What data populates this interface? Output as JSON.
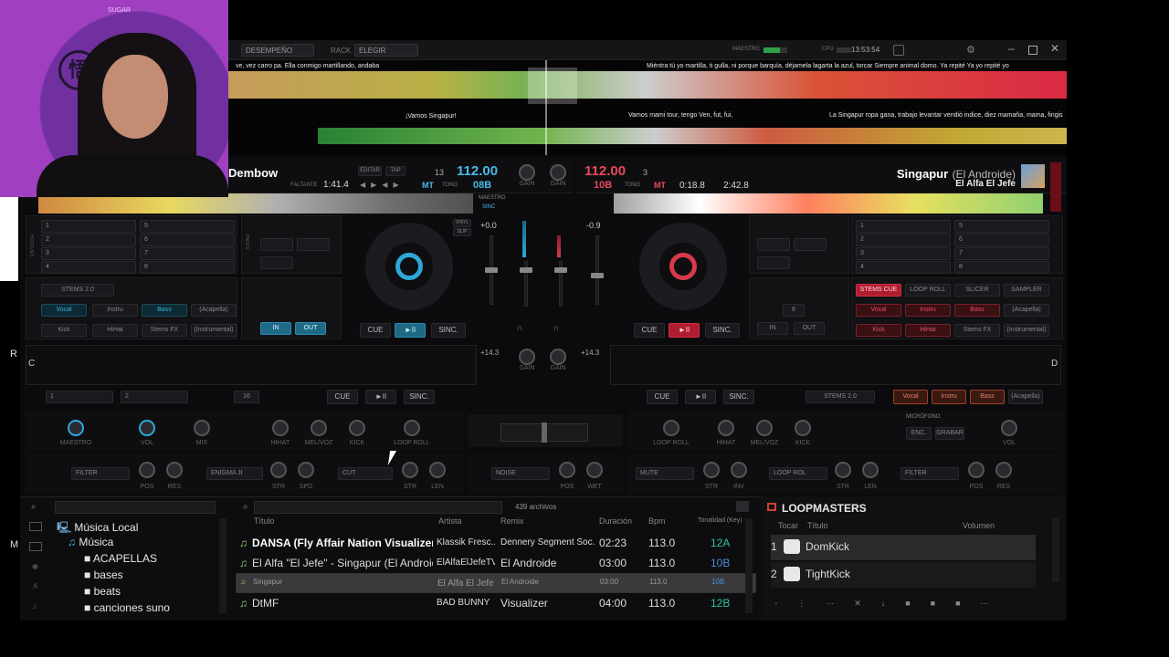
{
  "top_bar": {
    "mode_select": "DESEMPEÑO",
    "rack_label": "RACK",
    "rack_select": "ELEGIR",
    "master_label": "MAESTRO",
    "cpu_label": "CPU",
    "clock": "13:53:54"
  },
  "waveform_lyrics": {
    "deck_a_left": "ve, vez carro pa. Ella    conmigo martillando, andaba",
    "deck_a_right": "Miéntra    tú yo martilla, ti gulla, ni porque barquía, déjamela lagarta la azul, torcar Siempre animal domo. Ya repité Ya    yo repité yo",
    "deck_b_left": "¡Vamos Singapur!",
    "deck_b_mid": "Vamos mami tour, tengo Ven, fut, fui,",
    "deck_b_right": "La Singapur ropa gana, trabajo levantar vendió indice, diez mamaña, mama, fingis"
  },
  "deck_left": {
    "title": "Dembow",
    "remain_label": "FALTANTE",
    "time_remaining": "1:41.4",
    "edit_button": "EDITAR",
    "tap_button": "TAP",
    "bpm": "112.00",
    "pitch_range": "13",
    "key_mode": "MT",
    "tono_label": "TONO",
    "key": "08B",
    "master_label": "MAESTRO",
    "sync_label": "SINC",
    "pitch": "+0.0",
    "cue": "CUE",
    "play": "►II",
    "sync": "SINC.",
    "vinyl": "VINYL",
    "slip": "SLIP",
    "stems_preset": "STEMS 2.0",
    "loop_in": "IN",
    "loop_out": "OUT",
    "stem_buttons": [
      "Vocal",
      "Instru",
      "Bass",
      "(Acapella)",
      "Kick",
      "HiHat",
      "Stems FX",
      "(Instrumental)"
    ],
    "hotcues": [
      "1",
      "2",
      "3",
      "4",
      "5",
      "6",
      "7",
      "8"
    ],
    "fx_knobs": [
      "MAESTRO",
      "VOL",
      "MIX",
      "HIHAT",
      "MEL/VOZ",
      "KICK",
      "LOOP ROLL"
    ],
    "fx_row": [
      "FILTER",
      "POS",
      "RES",
      "ENIGMA JI",
      "STR",
      "SPD",
      "CUT",
      "STR",
      "LEN"
    ],
    "loop_size": "16",
    "sampler_slots": [
      "1",
      "2"
    ],
    "vert_labels": [
      "HOTCUES",
      "PADFX",
      "LOOP",
      "SAMPLER"
    ]
  },
  "deck_right": {
    "title": "Singapur",
    "remix": "(El Androide)",
    "artist": "El Alfa El Jefe",
    "bpm": "112.00",
    "pitch_range": "3",
    "key": "10B",
    "key_mode": "MT",
    "tono_label": "TONO",
    "elapsed": "0:18.8",
    "remaining": "2:42.8",
    "pitch": "-0.9",
    "cue": "CUE",
    "play": "►II",
    "sync": "SINC.",
    "loop_in": "IN",
    "loop_out": "OUT",
    "loop_size": "8",
    "pad_modes": [
      "STEMS CUE",
      "LOOP ROLL",
      "SLICER",
      "SAMPLER"
    ],
    "stem_buttons": [
      "Vocal",
      "Instru",
      "Bass",
      "(Acapella)",
      "Kick",
      "HiHat",
      "Stems FX",
      "(Instrumental)"
    ],
    "hotcues": [
      "1",
      "2",
      "3",
      "4",
      "5",
      "6",
      "7",
      "8"
    ],
    "fx_knobs": [
      "LOOP ROLL",
      "HIHAT",
      "MEL/VOZ",
      "KICK",
      "VOL"
    ],
    "fx_row": [
      "MUTE",
      "STR",
      "INV",
      "LOOP ROL",
      "STR",
      "LEN",
      "FILTER",
      "POS",
      "RES"
    ],
    "stems_preset": "STEMS 2.0",
    "mic_label": "MICRÓFONO",
    "mic_buttons": [
      "ENC.",
      "GRABAR"
    ],
    "mic_vol": "VOL"
  },
  "mixer": {
    "gain_labels": [
      "GAIN",
      "GAIN",
      "GAIN",
      "GAIN"
    ],
    "pitch_c": "+14.3",
    "pitch_d": "+14.3",
    "noise": "NOISE",
    "noise_knobs": [
      "POS",
      "WET"
    ]
  },
  "lower_decks": {
    "c_label": "C",
    "d_label": "D",
    "cue": "CUE",
    "play": "►II",
    "sync": "SINC.",
    "stem_buttons": [
      "Vocal",
      "Instru",
      "Bass",
      "(Acapella)"
    ]
  },
  "browser": {
    "files_count": "439 archivos",
    "tree": [
      "Música Local",
      "Música",
      "ACAPELLAS",
      "bases",
      "beats",
      "canciones suno"
    ],
    "columns": [
      "Título",
      "Artista",
      "Remix",
      "Duración",
      "Bpm",
      "Tonalidad (Key)"
    ],
    "rows": [
      {
        "title": "DANSA (Fly Affair Nation Visualizer)",
        "artist": "Klassik Fresc...",
        "remix": "Dennery Segment Soc...",
        "duration": "02:23",
        "bpm": "113.0",
        "key": "12A",
        "key_color": "#33c3a8"
      },
      {
        "title": "El Alfa \"El Jefe\" - Singapur (El Androide)",
        "artist": "ElAlfaElJefeTV",
        "remix": "El Androide",
        "duration": "03:00",
        "bpm": "113.0",
        "key": "10B",
        "key_color": "#4a8cd8"
      },
      {
        "title": "Singapur",
        "artist": "El Alfa El Jefe",
        "remix": "El Androide",
        "duration": "03:00",
        "bpm": "113.0",
        "key": "10B",
        "key_color": "#4a8cd8"
      },
      {
        "title": "DtMF",
        "artist": "BAD BUNNY",
        "remix": "Visualizer",
        "duration": "04:00",
        "bpm": "113.0",
        "key": "12B",
        "key_color": "#33c3a8"
      }
    ]
  },
  "loopmasters": {
    "title": "LOOPMASTERS",
    "columns": [
      "Tocar",
      "Título",
      "Volumen"
    ],
    "items": [
      {
        "num": "1",
        "name": "DomKick"
      },
      {
        "num": "2",
        "name": "TightKick"
      }
    ]
  },
  "webcam": {
    "logo_glyph": "悟",
    "sign_text": "SUGAR"
  },
  "side_labels": [
    "R",
    "M"
  ],
  "colors": {
    "accent_left": "#2ea7d6",
    "accent_right": "#d63a4a"
  }
}
